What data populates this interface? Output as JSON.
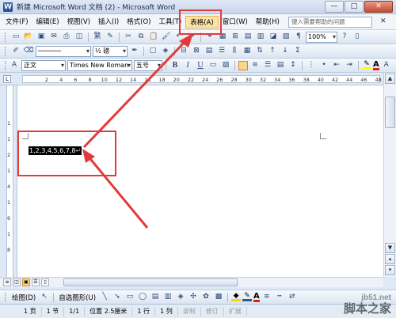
{
  "window": {
    "title": "新建 Microsoft Word 文档 (2) - Microsoft Word",
    "minimize": "—",
    "maximize": "□",
    "close": "✕"
  },
  "menu": {
    "items": [
      "文件(F)",
      "编辑(E)",
      "视图(V)",
      "插入(I)",
      "格式(O)",
      "工具(T)",
      "表格(A)",
      "窗口(W)",
      "帮助(H)"
    ],
    "active_index": 6,
    "help_placeholder": "键入需要帮助的问题",
    "close_doc": "✕"
  },
  "toolbar": {
    "font_size_top": "繁",
    "zoom": "100%",
    "indent": "½ 磅",
    "style": "正文",
    "font": "Times New Roman",
    "font_size": "五号",
    "bold": "B",
    "italic": "I",
    "underline": "U",
    "font_color_letter": "A",
    "big_a": "A",
    "small_a": "A"
  },
  "ruler": {
    "marks": [
      "2",
      "4",
      "6",
      "8",
      "10",
      "12",
      "14",
      "16",
      "18",
      "20",
      "22",
      "24",
      "26",
      "28",
      "30",
      "32",
      "34",
      "36",
      "38",
      "40",
      "42",
      "44",
      "46",
      "48"
    ],
    "tab_marker": "L",
    "vmarks": [
      "1",
      "1",
      "2",
      "1",
      "4",
      "1",
      "6",
      "1",
      "8"
    ]
  },
  "document": {
    "selected_text": "1,2,3,4,5,6,7,8",
    "para_mark": "↵"
  },
  "drawing": {
    "draw_label": "绘图(D)",
    "autoshape_label": "自选图形(U)"
  },
  "status": {
    "page": "1 页",
    "section": "1 节",
    "pages": "1/1",
    "position": "位置 2.5厘米",
    "line": "1 行",
    "column": "1 列",
    "rec": "录制",
    "trk": "修订",
    "ext": "扩展"
  },
  "watermark": {
    "url": "jb51.net",
    "brand": "脚本之家"
  },
  "colors": {
    "highlight_red": "#e23a3a",
    "menu_active_bg": "#fbe3a7"
  }
}
